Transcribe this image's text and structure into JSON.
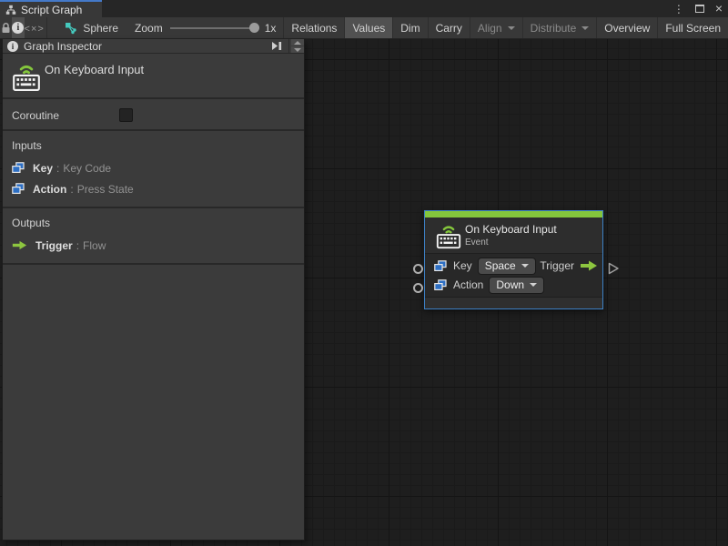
{
  "window": {
    "tab_label": "Script Graph"
  },
  "titlebar_icons": {
    "more": "more-options",
    "maximize": "maximize",
    "close": "close"
  },
  "toolbar": {
    "graph_name": "Sphere",
    "zoom_label": "Zoom",
    "zoom_display": "1x",
    "zoom_fraction": 1.0,
    "buttons": [
      {
        "label": "Relations",
        "state": "normal"
      },
      {
        "label": "Values",
        "state": "selected"
      },
      {
        "label": "Dim",
        "state": "normal"
      },
      {
        "label": "Carry",
        "state": "normal"
      },
      {
        "label": "Align",
        "state": "disabled",
        "has_dropdown": true
      },
      {
        "label": "Distribute",
        "state": "disabled",
        "has_dropdown": true
      },
      {
        "label": "Overview",
        "state": "normal"
      },
      {
        "label": "Full Screen",
        "state": "normal"
      }
    ]
  },
  "inspector": {
    "header": "Graph Inspector",
    "unit_title": "On Keyboard Input",
    "coroutine_label": "Coroutine",
    "coroutine_checked": false,
    "separator": ":",
    "inputs": {
      "header": "Inputs",
      "rows": [
        {
          "name": "Key",
          "type": "Key Code"
        },
        {
          "name": "Action",
          "type": "Press State"
        }
      ]
    },
    "outputs": {
      "header": "Outputs",
      "rows": [
        {
          "name": "Trigger",
          "type": "Flow"
        }
      ]
    }
  },
  "node": {
    "title": "On Keyboard Input",
    "subtitle": "Event",
    "ports": {
      "key_label": "Key",
      "key_value": "Space",
      "action_label": "Action",
      "action_value": "Down",
      "trigger_label": "Trigger"
    }
  },
  "colors": {
    "accent_green": "#84C63C",
    "flow_green": "#8DC63F",
    "selection_blue": "#3D80C4",
    "value_port_blue": "#2D6FC4",
    "tab_accent_blue": "#4479C8",
    "graph_icon_cyan": "#45C9BE",
    "canvas_bg": "#1E1E1E",
    "panel_bg": "#3B3B3B"
  }
}
